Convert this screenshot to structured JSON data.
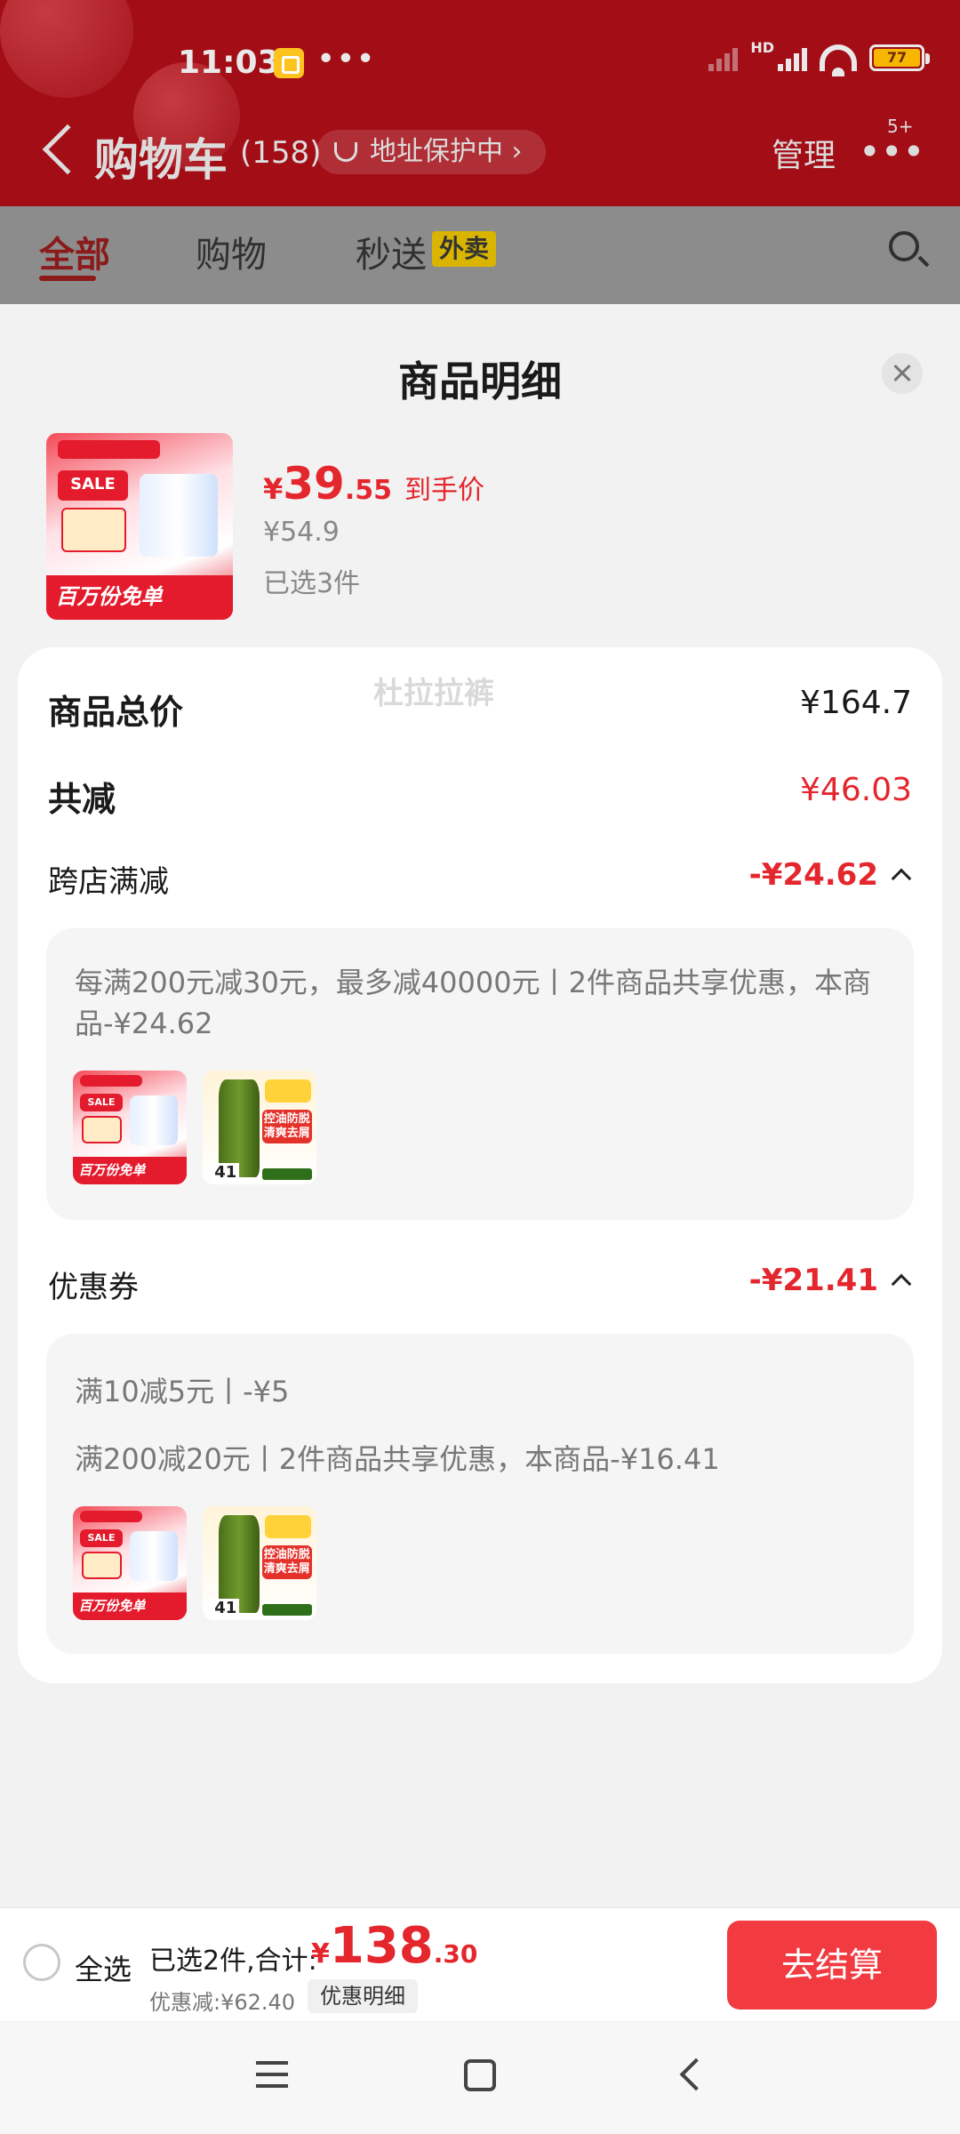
{
  "status_bar": {
    "time": "11:03",
    "dots": "•••",
    "network": "HD",
    "battery": "77"
  },
  "background": {
    "title": "购物车",
    "count": "(158)",
    "address_pill": "地址保护中 ›",
    "manage": "管理",
    "more": "•••",
    "badge": "5+",
    "tabs": [
      "全部",
      "购物",
      "秒送"
    ],
    "takeout_tag": "外卖"
  },
  "sheet": {
    "title": "商品明细",
    "product": {
      "price_symbol": "¥",
      "price_int": "39",
      "price_dec": ".55",
      "price_note": "到手价",
      "original_price": "¥54.9",
      "selected": "已选3件",
      "thumb_sale": "SALE",
      "thumb_banner": "百万份免单"
    },
    "total_label": "商品总价",
    "total_value": "¥164.7",
    "reduce_label": "共减",
    "reduce_value": "¥46.03",
    "cross_store": {
      "label": "跨店满减",
      "value": "-¥24.62",
      "description": "每满200元减30元，最多减40000元丨2件商品共享优惠，本商品-¥24.62",
      "watermark": "杜拉拉裤"
    },
    "coupon": {
      "label": "优惠券",
      "value": "-¥21.41",
      "line1": "满10减5元丨-¥5",
      "line2": "满200减20元丨2件商品共享优惠，本商品-¥16.41"
    },
    "thumb_b_label": "控油防脱\n清爽去屑",
    "thumb_b_num": "41"
  },
  "bottom_bar": {
    "select_all": "全选",
    "summary_label": "已选2件,合计:",
    "sum_symbol": "¥",
    "sum_int": "138",
    "sum_dec": ".30",
    "discount_label": "优惠减:¥62.40",
    "detail_button": "优惠明细",
    "checkout": "去结算"
  },
  "colors": {
    "accent": "#e4262d",
    "checkout": "#f23a41",
    "header_bg": "#a30d16"
  }
}
